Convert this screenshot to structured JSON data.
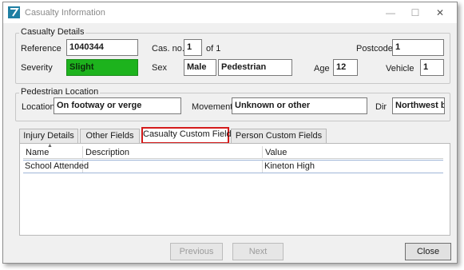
{
  "window": {
    "title": "Casualty Information",
    "minimize_glyph": "—",
    "maximize_glyph": "☐",
    "close_glyph": "✕"
  },
  "casualty_details": {
    "group_label": "Casualty Details",
    "reference_label": "Reference",
    "reference_value": "1040344",
    "cas_no_label": "Cas. no.",
    "cas_no_value": "1",
    "of_text": "of 1",
    "postcode_label": "Postcode",
    "postcode_value": "1",
    "severity_label": "Severity",
    "severity_value": "Slight",
    "severity_color": "#1db31d",
    "sex_label": "Sex",
    "sex_value": "Male",
    "class_value": "Pedestrian",
    "age_label": "Age",
    "age_value": "12",
    "vehicle_label": "Vehicle",
    "vehicle_value": "1"
  },
  "pedestrian_location": {
    "group_label": "Pedestrian Location",
    "location_label": "Location",
    "location_value": "On footway or verge",
    "movement_label": "Movement",
    "movement_value": "Unknown or other",
    "dir_label": "Dir",
    "dir_value": "Northwest bo"
  },
  "tabs": [
    {
      "label": "Injury Details"
    },
    {
      "label": "Other Fields"
    },
    {
      "label": "Casualty Custom Fields"
    },
    {
      "label": "Person Custom Fields"
    }
  ],
  "active_tab": "Casualty Custom Fields",
  "grid": {
    "columns": [
      "Name",
      "Description",
      "Value"
    ],
    "rows": [
      {
        "name": "School Attended",
        "description": "",
        "value": "Kineton High"
      }
    ]
  },
  "buttons": {
    "previous": "Previous",
    "next": "Next",
    "close": "Close"
  }
}
